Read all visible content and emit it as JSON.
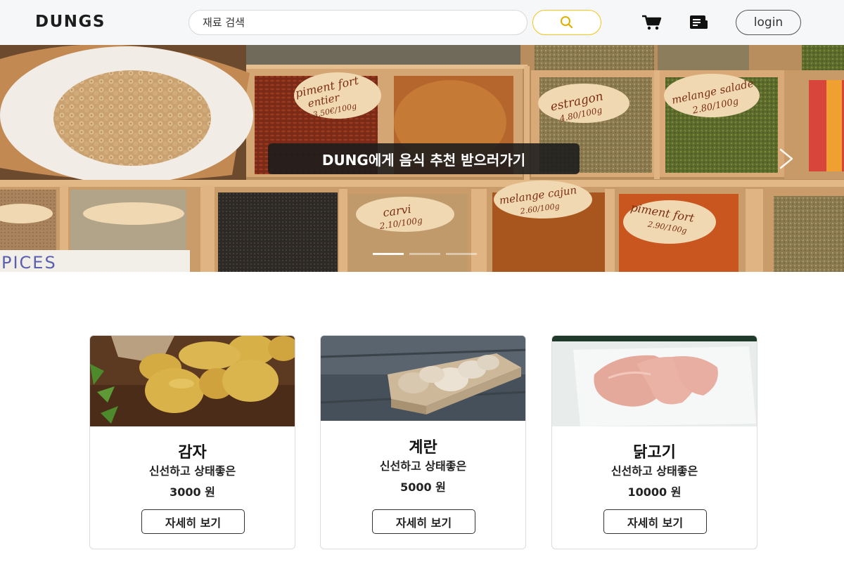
{
  "header": {
    "brand": "DUNGS",
    "search_placeholder": "재료 검색",
    "search_icon": "search-icon",
    "cart_icon": "cart-icon",
    "receipt_icon": "receipt-icon",
    "login_label": "login",
    "accent_color": "#f5c518"
  },
  "hero": {
    "cta_label": "DUNG에게 음식 추천 받으러가기",
    "next_icon": "chevron-right-icon",
    "slide_count": 3,
    "active_slide": 1,
    "labels": {
      "piment_top": "piment fort",
      "piment_top_sub": "entier",
      "piment_top_price": "3,50€/100g",
      "estragon": "estragon",
      "estragon_price": "4.80/100g",
      "melange_top": "melange salade",
      "melange_top_price": "2.80/100g",
      "carvi": "carvi",
      "carvi_price": "2.10/100g",
      "melange_bottom": "melange cajun",
      "melange_bottom_price": "2.60/100g",
      "piment_bottom": "piment fort",
      "piment_bottom_price": "2.90/100g",
      "spices_sign": "PICES"
    }
  },
  "products": [
    {
      "name": "감자",
      "desc": "신선하고 상태좋은",
      "price": "3000 원",
      "button": "자세히 보기"
    },
    {
      "name": "계란",
      "desc": "신선하고 상태좋은",
      "price": "5000 원",
      "button": "자세히 보기"
    },
    {
      "name": "닭고기",
      "desc": "신선하고 상태좋은",
      "price": "10000 원",
      "button": "자세히 보기"
    }
  ]
}
